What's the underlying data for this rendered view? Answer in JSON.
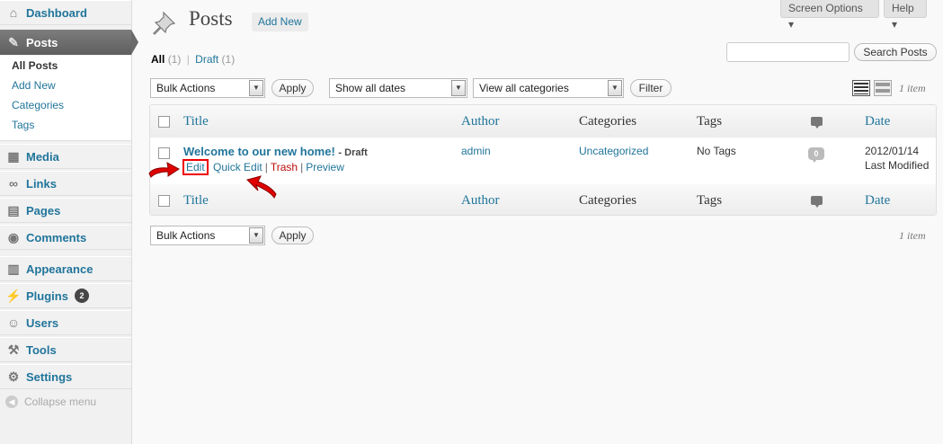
{
  "window": {
    "screen_options": "Screen Options ▾",
    "help": "Help ▾"
  },
  "sidebar": {
    "items": [
      {
        "label": "Dashboard",
        "icon": "dashboard-icon"
      },
      {
        "label": "Posts",
        "icon": "pushpin-icon"
      },
      {
        "label": "Media",
        "icon": "media-icon"
      },
      {
        "label": "Links",
        "icon": "links-icon"
      },
      {
        "label": "Pages",
        "icon": "pages-icon"
      },
      {
        "label": "Comments",
        "icon": "comments-icon"
      },
      {
        "label": "Appearance",
        "icon": "appearance-icon"
      },
      {
        "label": "Plugins",
        "icon": "plugins-icon",
        "badge": "2"
      },
      {
        "label": "Users",
        "icon": "users-icon"
      },
      {
        "label": "Tools",
        "icon": "tools-icon"
      },
      {
        "label": "Settings",
        "icon": "settings-icon"
      }
    ],
    "submenu": [
      "All Posts",
      "Add New",
      "Categories",
      "Tags"
    ],
    "collapse": "Collapse menu"
  },
  "header": {
    "title": "Posts",
    "add_new": "Add New"
  },
  "filters": {
    "all_label": "All",
    "all_count": "(1)",
    "separator": "|",
    "draft_label": "Draft",
    "draft_count": "(1)",
    "search_button": "Search Posts",
    "bulk_actions": "Bulk Actions",
    "apply": "Apply",
    "dates": "Show all dates",
    "categories": "View all categories",
    "filter": "Filter",
    "item_count": "1 item"
  },
  "table": {
    "columns": {
      "title": "Title",
      "author": "Author",
      "categories": "Categories",
      "tags": "Tags",
      "date": "Date"
    },
    "rows": [
      {
        "title": "Welcome to our new home!",
        "state": "- Draft",
        "author": "admin",
        "categories": "Uncategorized",
        "tags": "No Tags",
        "comments": "0",
        "date": "2012/01/14",
        "date_status": "Last Modified",
        "actions": {
          "edit": "Edit",
          "quick_edit": "Quick Edit",
          "trash": "Trash",
          "preview": "Preview"
        }
      }
    ]
  },
  "colors": {
    "link": "#21759b",
    "active_menu": "#6a6a6a",
    "trash": "#bc0b0b",
    "highlight": "#e00000",
    "annotation_arrow": "#e00000"
  }
}
